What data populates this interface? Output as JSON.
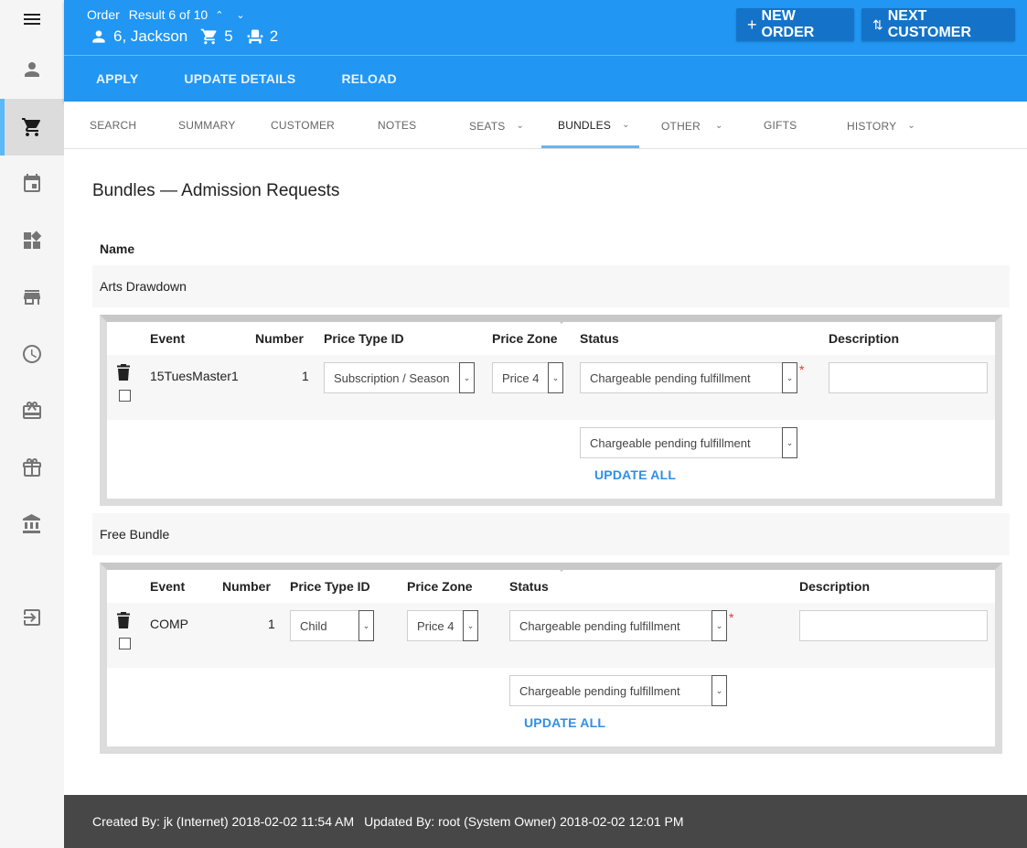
{
  "sidebar": {
    "items": [
      {
        "name": "menu",
        "icon": "hamburger-menu-icon"
      },
      {
        "name": "customer",
        "icon": "person-icon"
      },
      {
        "name": "orders",
        "icon": "shopping-cart-icon",
        "active": true
      },
      {
        "name": "events",
        "icon": "calendar-icon"
      },
      {
        "name": "widgets",
        "icon": "widgets-icon"
      },
      {
        "name": "store",
        "icon": "storefront-icon"
      },
      {
        "name": "history",
        "icon": "clock-icon"
      },
      {
        "name": "gift-card",
        "icon": "gift-card-icon"
      },
      {
        "name": "gifts",
        "icon": "gift-icon"
      },
      {
        "name": "bank",
        "icon": "bank-icon"
      },
      {
        "name": "sign-in",
        "icon": "sign-in-icon"
      }
    ]
  },
  "header": {
    "order_label": "Order",
    "result_text": "Result 6 of 10",
    "customer": "6, Jackson",
    "cart_count": "5",
    "seat_count": "2",
    "new_order_label": "NEW ORDER",
    "next_customer_label": "NEXT CUSTOMER",
    "actions": [
      "APPLY",
      "UPDATE DETAILS",
      "RELOAD"
    ]
  },
  "tabs": [
    {
      "label": "SEARCH",
      "dropdown": false
    },
    {
      "label": "SUMMARY",
      "dropdown": false
    },
    {
      "label": "CUSTOMER",
      "dropdown": false
    },
    {
      "label": "NOTES",
      "dropdown": false
    },
    {
      "label": "SEATS",
      "dropdown": true
    },
    {
      "label": "BUNDLES",
      "dropdown": true,
      "active": true
    },
    {
      "label": "OTHER",
      "dropdown": true
    },
    {
      "label": "GIFTS",
      "dropdown": false
    },
    {
      "label": "HISTORY",
      "dropdown": true
    }
  ],
  "page": {
    "title": "Bundles — Admission Requests",
    "name_header": "Name"
  },
  "columns": {
    "event": "Event",
    "number": "Number",
    "price_type": "Price Type ID",
    "price_zone": "Price Zone",
    "status": "Status",
    "description": "Description"
  },
  "bundles": [
    {
      "name": "Arts Drawdown",
      "rows": [
        {
          "event": "15TuesMaster1",
          "number": "1",
          "price_type": "Subscription / Season",
          "price_zone": "Price 4",
          "status": "Chargeable pending fulfillment",
          "description": ""
        }
      ],
      "bulk_status": "Chargeable pending fulfillment",
      "update_all_label": "UPDATE ALL"
    },
    {
      "name": "Free Bundle",
      "rows": [
        {
          "event": "COMP",
          "number": "1",
          "price_type": "Child",
          "price_zone": "Price 4",
          "status": "Chargeable pending fulfillment",
          "description": ""
        }
      ],
      "bulk_status": "Chargeable pending fulfillment",
      "update_all_label": "UPDATE ALL"
    }
  ],
  "footer": {
    "created": "Created By: jk (Internet) 2018-02-02 11:54 AM",
    "updated": "Updated By: root (System Owner) 2018-02-02 12:01 PM"
  },
  "colors": {
    "primary": "#2196f3",
    "primary_dark": "#1473c9",
    "accent_link": "#2e8fe8",
    "active_indicator": "#5ab9f7",
    "footer_bg": "#474747",
    "required": "#e53935"
  }
}
